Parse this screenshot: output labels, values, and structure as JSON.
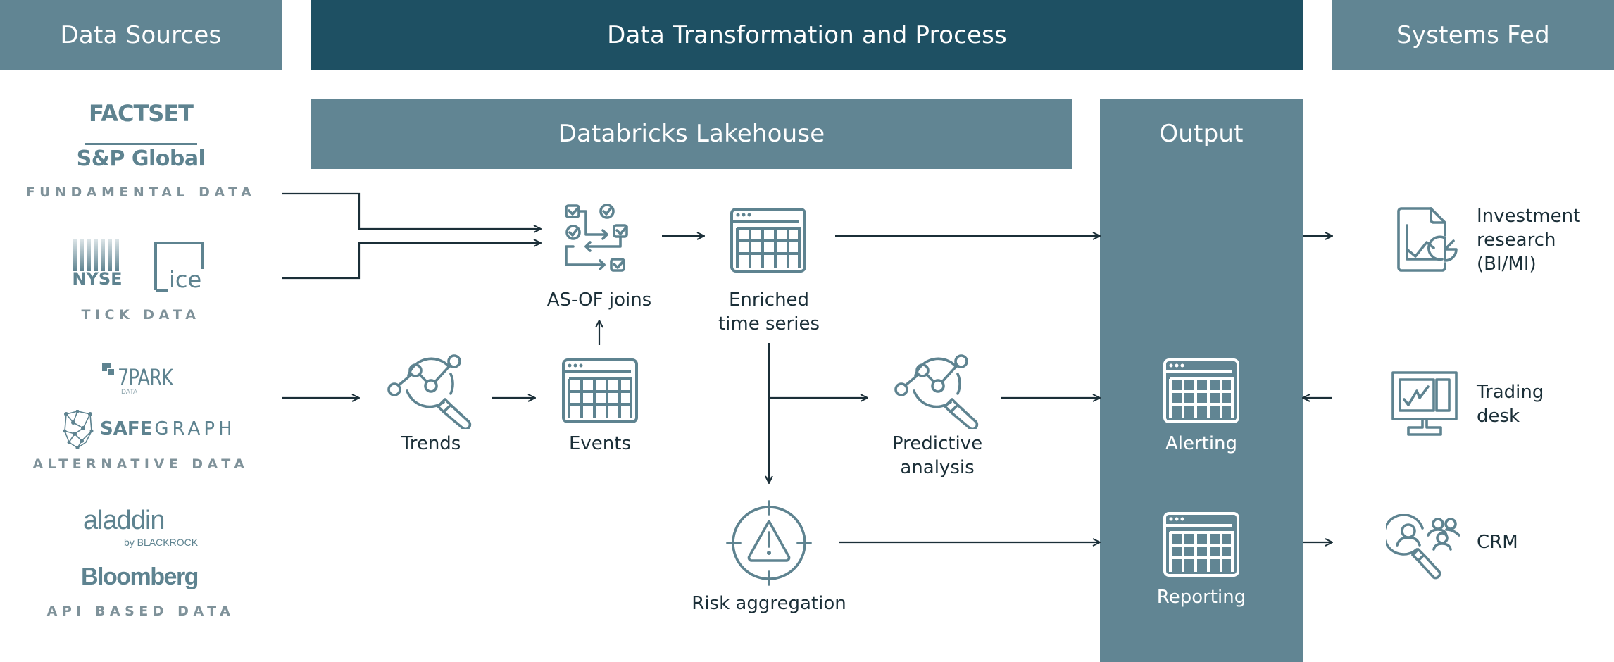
{
  "headers": {
    "data_sources": "Data Sources",
    "transformation": "Data Transformation and Process",
    "systems_fed": "Systems Fed"
  },
  "lakehouse": {
    "title": "Databricks Lakehouse"
  },
  "output": {
    "title": "Output",
    "items": [
      {
        "label": "Alerting",
        "icon": "table-grid-icon"
      },
      {
        "label": "Reporting",
        "icon": "table-grid-icon"
      }
    ]
  },
  "sources": {
    "fundamental": {
      "logos": [
        "FACTSET",
        "S&P Global"
      ],
      "label": "FUNDAMENTAL DATA"
    },
    "tick": {
      "logos": [
        "NYSE",
        "ice"
      ],
      "label": "TICK DATA"
    },
    "alternative": {
      "logos": [
        "7PARK",
        "DATA",
        "SAFE",
        "GRAPH"
      ],
      "label": "ALTERNATIVE DATA"
    },
    "api": {
      "logos": [
        "aladdin",
        "by BLACKROCK",
        "Bloomberg"
      ],
      "label": "API BASED DATA"
    }
  },
  "process": {
    "asof": {
      "label": "AS-OF joins",
      "icon": "workflow-checklist-icon"
    },
    "enriched": {
      "label_line1": "Enriched",
      "label_line2": "time series",
      "icon": "table-grid-icon"
    },
    "trends": {
      "label": "Trends",
      "icon": "analytics-magnifier-icon"
    },
    "events": {
      "label": "Events",
      "icon": "table-grid-icon"
    },
    "predictive": {
      "label_line1": "Predictive",
      "label_line2": "analysis",
      "icon": "analytics-magnifier-icon"
    },
    "risk": {
      "label": "Risk aggregation",
      "icon": "warning-target-icon"
    }
  },
  "systems": [
    {
      "label_lines": [
        "Investment",
        "research",
        "(BI/MI)"
      ],
      "icon": "report-chart-icon"
    },
    {
      "label_lines": [
        "Trading",
        "desk"
      ],
      "icon": "monitor-chart-icon"
    },
    {
      "label_lines": [
        "CRM"
      ],
      "icon": "people-search-icon"
    }
  ],
  "colors": {
    "header_dark": "#1e5063",
    "header_light": "#618593",
    "icon_stroke": "#5e8390",
    "connector": "#1b2f38",
    "source_label": "#7f929a"
  }
}
